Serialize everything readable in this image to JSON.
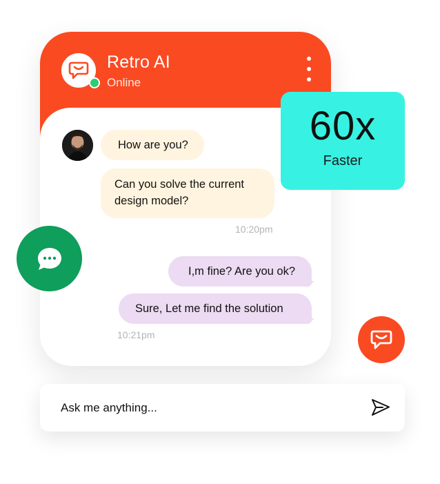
{
  "header": {
    "title": "Retro AI",
    "status": "Online"
  },
  "messages": [
    {
      "from": "user",
      "text": "How are you?"
    },
    {
      "from": "user",
      "text": "Can you solve  the current design model?"
    },
    {
      "from": "bot",
      "text": "I,m fine? Are you ok?"
    },
    {
      "from": "bot",
      "text": "Sure, Let me find the solution"
    }
  ],
  "timestamps": {
    "incoming": "10:20pm",
    "outgoing": "10:21pm"
  },
  "stat": {
    "value": "60x",
    "label": "Faster"
  },
  "input": {
    "placeholder": "Ask me anything..."
  },
  "icons": {
    "brand": "chat-bubble-icon",
    "menu": "kebab-menu-icon",
    "floating_green": "chat-dots-icon",
    "floating_orange": "chat-bubble-icon",
    "send": "send-icon"
  },
  "colors": {
    "accent": "#fa4a22",
    "stat_bg": "#37f2e2",
    "green": "#0f9e5b",
    "incoming_bubble": "#fff4df",
    "outgoing_bubble": "#ecdbf2"
  }
}
